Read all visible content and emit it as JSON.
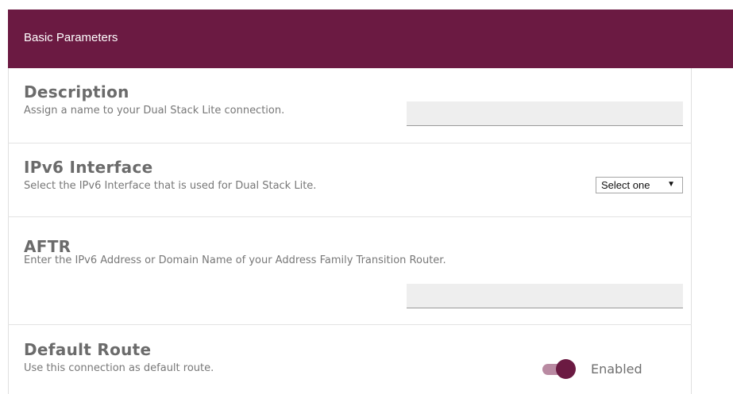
{
  "panel": {
    "title": "Basic Parameters"
  },
  "fields": {
    "description": {
      "title": "Description",
      "desc": "Assign a name to your Dual Stack Lite connection.",
      "value": ""
    },
    "ipv6_interface": {
      "title": "IPv6 Interface",
      "desc": "Select the IPv6 Interface that is used for Dual Stack Lite.",
      "selected": "Select one"
    },
    "aftr": {
      "title": "AFTR",
      "desc": "Enter the IPv6 Address or Domain Name of your Address Family Transition Router.",
      "value": ""
    },
    "default_route": {
      "title": "Default Route",
      "desc": "Use this connection as default route.",
      "state_label": "Enabled",
      "enabled": true
    }
  },
  "colors": {
    "brand": "#6b1a42",
    "toggle_track": "#b98aa2"
  },
  "icons": {
    "select_arrow": "triangle-down-icon"
  }
}
